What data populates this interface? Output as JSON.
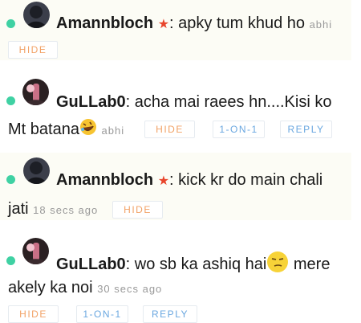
{
  "messages": [
    {
      "user": "Amannbloch",
      "text_a": ": apky tum khud ho",
      "text_b": "",
      "meta": "abhi",
      "hide": "HIDE"
    },
    {
      "user": "GuLLab0",
      "text_a": ": acha mai raees hn....Kisi ko",
      "text_b": "Mt batana",
      "meta": "abhi",
      "hide": "HIDE",
      "one": "1-ON-1",
      "reply": "REPLY"
    },
    {
      "user": "Amannbloch",
      "text_a": ": kick kr do main chali",
      "text_b": "jati",
      "meta": "18 secs ago",
      "hide": "HIDE"
    },
    {
      "user": "GuLLab0",
      "text_a": ": wo sb ka ashiq hai",
      "text_a2": " mere",
      "text_b": "akely ka noi",
      "meta": "30 secs ago",
      "hide": "HIDE",
      "one": "1-ON-1",
      "reply": "REPLY"
    }
  ],
  "colors": {
    "online": "#3fd1a3",
    "hide": "#f2a266",
    "action": "#6aa7e0",
    "star": "#e8452c"
  },
  "icons": {
    "badge": "star-icon",
    "laugh": "rofl-emoji-icon",
    "smirk": "smirk-emoji-icon"
  }
}
